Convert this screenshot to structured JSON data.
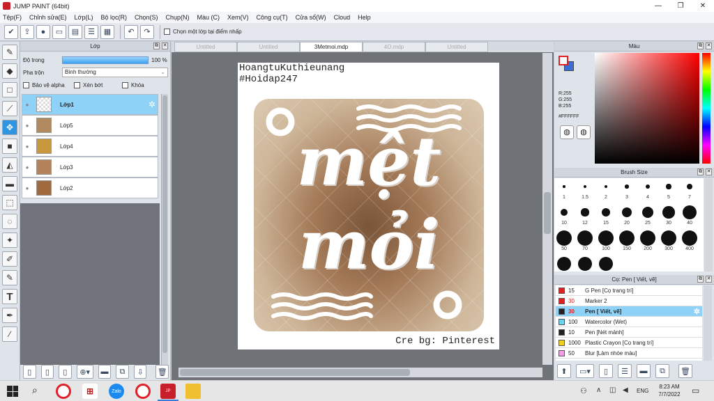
{
  "window": {
    "title": "JUMP PAINT (64bit)"
  },
  "menu": [
    "Tệp(F)",
    "Chỉnh sửa(E)",
    "Lớp(L)",
    "Bộ lọc(R)",
    "Chọn(S)",
    "Chụp(N)",
    "Màu (C)",
    "Xem(V)",
    "Công cụ(T)",
    "Cửa sổ(W)",
    "Cloud",
    "Help"
  ],
  "toolbar": {
    "checkbox_label": "Chọn một lớp tại điểm nhấp"
  },
  "layer_panel": {
    "title": "Lớp",
    "opacity_label": "Độ trong",
    "opacity_value": "100 %",
    "opacity_fraction": 1,
    "blend_label": "Pha trộn",
    "blend_value": "Bình thường",
    "protect_alpha": "Bảo vệ alpha",
    "clip": "Xén bớt",
    "lock": "Khóa",
    "layers": [
      {
        "name": "Lớp1",
        "selected": true
      },
      {
        "name": "Lớp5"
      },
      {
        "name": "Lớp4"
      },
      {
        "name": "Lớp3"
      },
      {
        "name": "Lớp2"
      }
    ]
  },
  "tabs": [
    {
      "label": "Untitled"
    },
    {
      "label": "Untitled"
    },
    {
      "label": "3Metmoi.mdp",
      "active": true
    },
    {
      "label": "4O.mdp"
    },
    {
      "label": "Untitled"
    }
  ],
  "canvas": {
    "line1": "HoangtuKuthieunang",
    "line2": "#Hoidap247",
    "word1": "mệt",
    "word2": "mỏi",
    "credit": "Cre bg: Pinterest"
  },
  "color_panel": {
    "title": "Màu",
    "r": "R:255",
    "g": "G:255",
    "b": "B:255",
    "hex": "#FFFFFF",
    "primary": "#FFFFFF",
    "secondary": "#3a6fd8"
  },
  "brush_panel": {
    "title": "Brush Size",
    "sizes": [
      "1",
      "1.5",
      "2",
      "3",
      "4",
      "5",
      "7",
      "10",
      "12",
      "15",
      "20",
      "25",
      "30",
      "40",
      "50",
      "70",
      "100",
      "150",
      "200",
      "300",
      "400"
    ]
  },
  "pen_panel": {
    "title": "Cọ: Pen [ Viết, vẽ]",
    "items": [
      {
        "size": "15",
        "name": "G Pen [Cọ trang trí]",
        "color": "#e02020"
      },
      {
        "size": "30",
        "name": "Marker 2",
        "color": "#e02020"
      },
      {
        "size": "30",
        "name": "Pen [ Viết, vẽ]",
        "color": "#222222",
        "selected": true
      },
      {
        "size": "100",
        "name": "Watercolor (Wet)",
        "color": "#6fd0f0"
      },
      {
        "size": "10",
        "name": "Pen [Nét mảnh]",
        "color": "#222222"
      },
      {
        "size": "1000",
        "name": "Plastic Crayon [Cọ trang trí]",
        "color": "#f0d020"
      },
      {
        "size": "50",
        "name": "Blur [Làm nhòe màu]",
        "color": "#f0a0e0"
      }
    ]
  },
  "taskbar": {
    "time": "8:23 AM",
    "date": "7/7/2022",
    "lang": "ENG"
  }
}
